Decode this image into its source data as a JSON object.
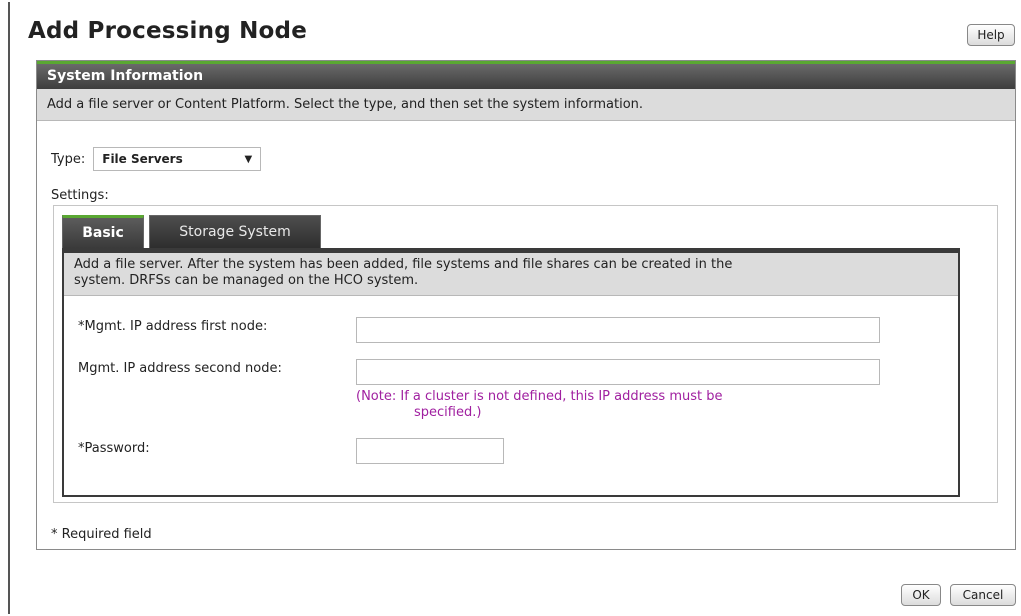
{
  "dialog": {
    "title": "Add Processing Node",
    "help_label": "Help"
  },
  "panel": {
    "header": "System Information",
    "description": "Add a file server or Content Platform. Select the type, and then set the system information.",
    "type_label": "Type:",
    "type_value": "File Servers",
    "settings_label": "Settings:",
    "tabs": [
      {
        "label": "Basic",
        "active": true
      },
      {
        "label": "Storage System",
        "active": false
      }
    ],
    "basic": {
      "description_line1": "Add a file server. After the system has been added, file systems and file shares can be created in the",
      "description_line2": "system. DRFSs can be managed on the HCO system.",
      "fields": {
        "ip_first_label": "*Mgmt. IP address first node:",
        "ip_first_value": "",
        "ip_second_label": "Mgmt. IP address second node:",
        "ip_second_value": "",
        "note_line1": "(Note: If a cluster is not defined, this IP address must be",
        "note_line2": "specified.)",
        "password_label": "*Password:",
        "password_value": ""
      }
    },
    "required_note": "* Required field"
  },
  "footer": {
    "ok_label": "OK",
    "cancel_label": "Cancel"
  },
  "colors": {
    "accent": "#5aa832",
    "header_bg": "#3d3d3d",
    "note_text": "#a020a0"
  }
}
